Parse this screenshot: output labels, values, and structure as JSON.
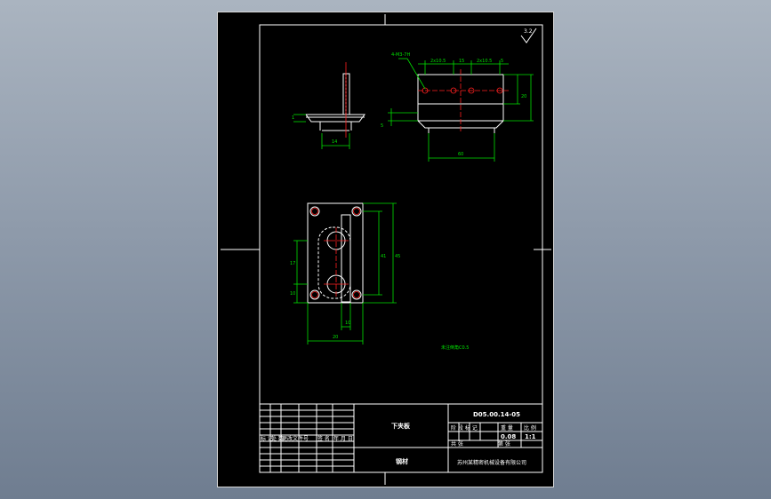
{
  "title_block": {
    "part_name": "下夹板",
    "drawing_number": "D05.00.14-05",
    "material": "钢材",
    "weight": "0.08",
    "scale": "1:1",
    "company": "苏州某精密机械设备有限公司",
    "label_mark": "标 记",
    "label_count": "处 数",
    "label_zone": "分 区",
    "label_change_doc": "更改文件号",
    "label_signature": "签 名",
    "label_date": "年 月 日",
    "label_stage_mark": "阶 段 标 记",
    "label_weight": "重 量",
    "label_scale": "比 例",
    "label_sheet": "共 张",
    "label_sheet_of": "第 张"
  },
  "annotations": {
    "roughness_symbol": "3.2",
    "technical_note": "未注倒角C0.5",
    "hole_callout": "4-M3-7H"
  },
  "dimensions": {
    "plan_width": "20",
    "plan_height": "45",
    "plan_inner": "41",
    "plan_gap": "10",
    "plan_left_v1": "17",
    "plan_left_v2": "10",
    "front_overall": "60",
    "front_d1": "2x10.5",
    "front_d2": "15",
    "front_d3": "2x10.5",
    "front_d4": "5",
    "front_height": "20",
    "front_left_v": "5",
    "side_width": "14",
    "side_v": "1"
  },
  "colors": {
    "outline": "#ffffff",
    "dimension": "#00e000",
    "center": "#ff2020",
    "background": "#000000",
    "frame_bg": "#8f9bab"
  }
}
